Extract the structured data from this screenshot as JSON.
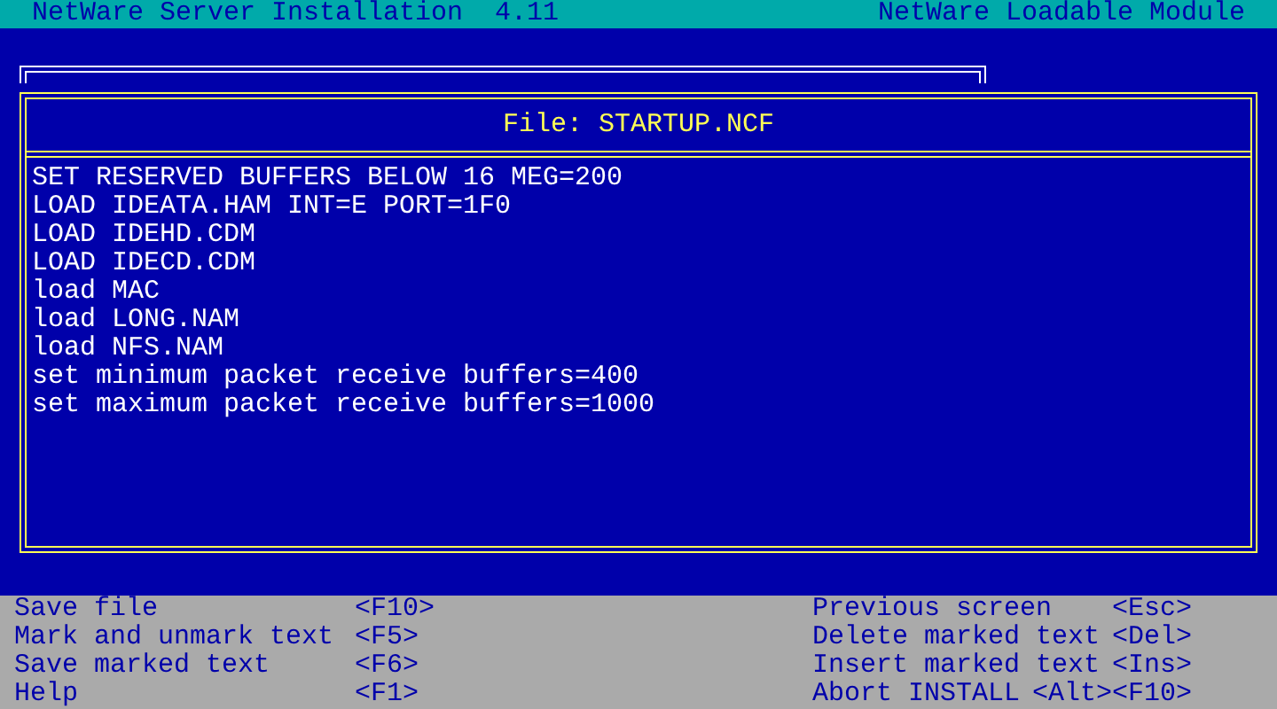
{
  "header": {
    "title": "NetWare Server Installation  4.11",
    "module": "NetWare Loadable Module"
  },
  "editor": {
    "title": "File: STARTUP.NCF",
    "lines": [
      "SET RESERVED BUFFERS BELOW 16 MEG=200",
      "LOAD IDEATA.HAM INT=E PORT=1F0",
      "LOAD IDEHD.CDM",
      "LOAD IDECD.CDM",
      "load MAC",
      "load LONG.NAM",
      "load NFS.NAM",
      "set minimum packet receive buffers=400",
      "set maximum packet receive buffers=1000"
    ]
  },
  "help_left": [
    {
      "action": "Save file",
      "key": "<F10>"
    },
    {
      "action": "Mark and unmark text",
      "key": "<F5>"
    },
    {
      "action": "Save marked text",
      "key": "<F6>"
    },
    {
      "action": "Help",
      "key": "<F1>"
    }
  ],
  "help_right": [
    {
      "action": "Previous screen",
      "key": "<Esc>"
    },
    {
      "action": "Delete marked text",
      "key": "<Del>"
    },
    {
      "action": "Insert marked text",
      "key": "<Ins>"
    },
    {
      "action": "Abort INSTALL",
      "key": "<Alt><F10>"
    }
  ]
}
